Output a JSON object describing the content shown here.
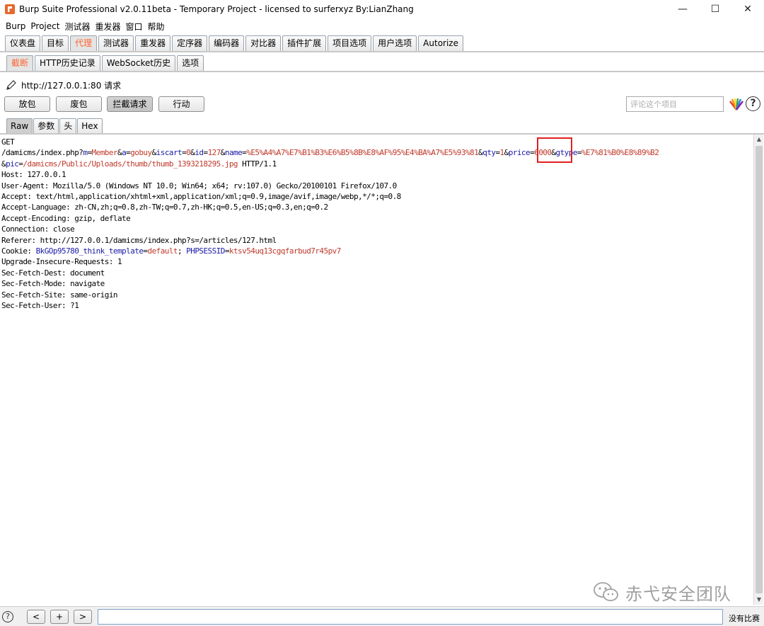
{
  "window": {
    "title": "Burp Suite Professional v2.0.11beta - Temporary Project - licensed to surferxyz By:LianZhang",
    "minimize": "—",
    "maximize": "☐",
    "close": "✕"
  },
  "menu": [
    "Burp",
    "Project",
    "测试器",
    "重发器",
    "窗口",
    "帮助"
  ],
  "main_tabs": [
    "仪表盘",
    "目标",
    "代理",
    "测试器",
    "重发器",
    "定序器",
    "编码器",
    "对比器",
    "插件扩展",
    "项目选项",
    "用户选项",
    "Autorize"
  ],
  "main_tab_active": "代理",
  "sub_tabs": [
    "截断",
    "HTTP历史记录",
    "WebSocket历史",
    "选项"
  ],
  "sub_tab_active": "截断",
  "request_label": "http://127.0.0.1:80 请求",
  "buttons": {
    "forward": "放包",
    "drop": "废包",
    "intercept": "拦截请求",
    "action": "行动"
  },
  "comment_placeholder": "评论这个项目",
  "help_glyph": "?",
  "view_tabs": [
    "Raw",
    "参数",
    "头",
    "Hex"
  ],
  "view_tab_active": "Raw",
  "request": {
    "method": "GET",
    "path": "/damicms/index.php?",
    "query_line1": [
      {
        "k": "m",
        "v": "Member"
      },
      {
        "k": "a",
        "v": "gobuy"
      },
      {
        "k": "iscart",
        "v": "0"
      },
      {
        "k": "id",
        "v": "127"
      },
      {
        "k": "name",
        "v": "%E5%A4%A7%E7%B1%B3%E6%B5%8B%E8%AF%95%E4%BA%A7%E5%93%81"
      },
      {
        "k": "qty",
        "v": "1"
      },
      {
        "k": "price",
        "v": "6000"
      },
      {
        "k": "gtype",
        "v": "%E7%81%B0%E8%89%B2"
      }
    ],
    "query_line2": [
      {
        "k": "pic",
        "v": "/damicms/Public/Uploads/thumb/thumb_1393218295.jpg"
      }
    ],
    "protocol": " HTTP/1.1",
    "headers": [
      "Host: 127.0.0.1",
      "User-Agent: Mozilla/5.0 (Windows NT 10.0; Win64; x64; rv:107.0) Gecko/20100101 Firefox/107.0",
      "Accept: text/html,application/xhtml+xml,application/xml;q=0.9,image/avif,image/webp,*/*;q=0.8",
      "Accept-Language: zh-CN,zh;q=0.8,zh-TW;q=0.7,zh-HK;q=0.5,en-US;q=0.3,en;q=0.2",
      "Accept-Encoding: gzip, deflate",
      "Connection: close",
      "Referer: http://127.0.0.1/damicms/index.php?s=/articles/127.html"
    ],
    "cookie_label": "Cookie: ",
    "cookies": [
      {
        "k": "BkGOp95780_think_template",
        "v": "default"
      },
      {
        "k": "PHPSESSID",
        "v": "ktsv54uq13cgqfarbud7r45pv7"
      }
    ],
    "headers_after": [
      "Upgrade-Insecure-Requests: 1",
      "Sec-Fetch-Dest: document",
      "Sec-Fetch-Mode: navigate",
      "Sec-Fetch-Site: same-origin",
      "Sec-Fetch-User: ?1"
    ]
  },
  "watermark": "赤弋安全团队",
  "bottom": {
    "help": "?",
    "prev": "<",
    "add": "+",
    "next": ">",
    "match_text": "没有比赛"
  },
  "colors": {
    "param_key": "#1a1aa6",
    "param_value": "#c0392b",
    "active_tab": "#ff6633",
    "highlight": "#e02020"
  }
}
